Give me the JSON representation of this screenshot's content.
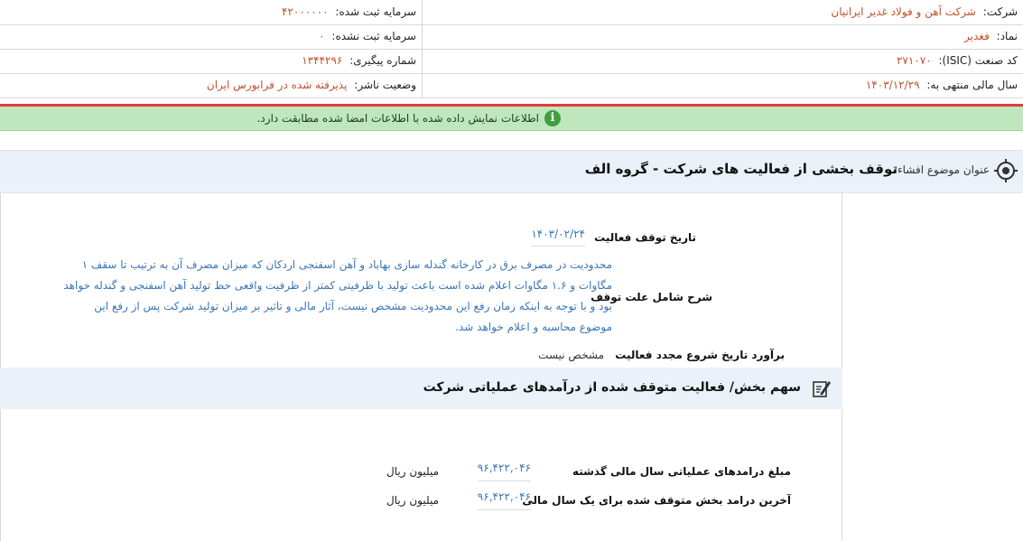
{
  "company": {
    "company_label": "شرکت:",
    "company_value": "شرکت آهن و فولاد غدیر ایرانیان",
    "symbol_label": "نماد:",
    "symbol_value": "فغدیر",
    "isic_label": "کد صنعت (ISIC):",
    "isic_value": "۲۷۱۰۷۰",
    "fiscal_label": "سال مالی منتهی به:",
    "fiscal_value": "۱۴۰۳/۱۲/۲۹",
    "reg_capital_label": "سرمایه ثبت شده:",
    "reg_capital_value": "۴۲۰۰۰۰۰۰",
    "unreg_capital_label": "سرمایه ثبت نشده:",
    "unreg_capital_value": "۰",
    "tracking_label": "شماره پیگیری:",
    "tracking_value": "۱۳۴۴۲۹۶",
    "publisher_status_label": "وضعیت ناشر:",
    "publisher_status_value": "پذیرفته شده در فرابورس ایران"
  },
  "alert": {
    "text": "اطلاعات نمایش داده شده با اطلاعات امضا شده مطابقت دارد."
  },
  "subject": {
    "label": "عنوان موضوع افشاء:",
    "value": "توقف بخشی از فعالیت های شرکت - گروه الف"
  },
  "details": {
    "stop_date_label": "تاریخ توقف فعالیت",
    "stop_date_value": "۱۴۰۳/۰۲/۲۴",
    "reason_label": "شرح شامل علت توقف",
    "reason_value": "محدودیت در مصرف برق در کارخانه گندله سازی بهاباد و آهن اسفنجی اردکان که میزان مصرف آن به ترتیب تا سقف ۱ مگاوات و ۱.۶ مگاوات اعلام شده است باعث تولید با ظرفیتی کمتر از ظرفیت واقعی خط تولید آهن اسفنجی و گندله خواهد بود و با توجه به اینکه زمان رفع این محدودیت مشخص نیست، آثار مالی و تاثیر بر میزان تولید شرکت پس از رفع این موضوع محاسبه و اعلام خواهد شد.",
    "restart_label": "برآورد تاریخ شروع مجدد فعالیت",
    "restart_value": "مشخص نیست"
  },
  "revenue_section": {
    "title": "سهم بخش/ فعالیت متوقف شده از درآمدهای عملیاتی شرکت",
    "last_year_label": "مبلغ درامدهای عملیاتی سال مالی گذشته",
    "last_year_value": "۹۶,۴۲۲,۰۴۶",
    "last_year_unit": "میلیون ریال",
    "stopped_label": "آخرین درامد بخش متوقف شده برای یک سال مالی",
    "stopped_value": "۹۶,۴۲۲,۰۴۶",
    "stopped_unit": "میلیون ریال"
  }
}
